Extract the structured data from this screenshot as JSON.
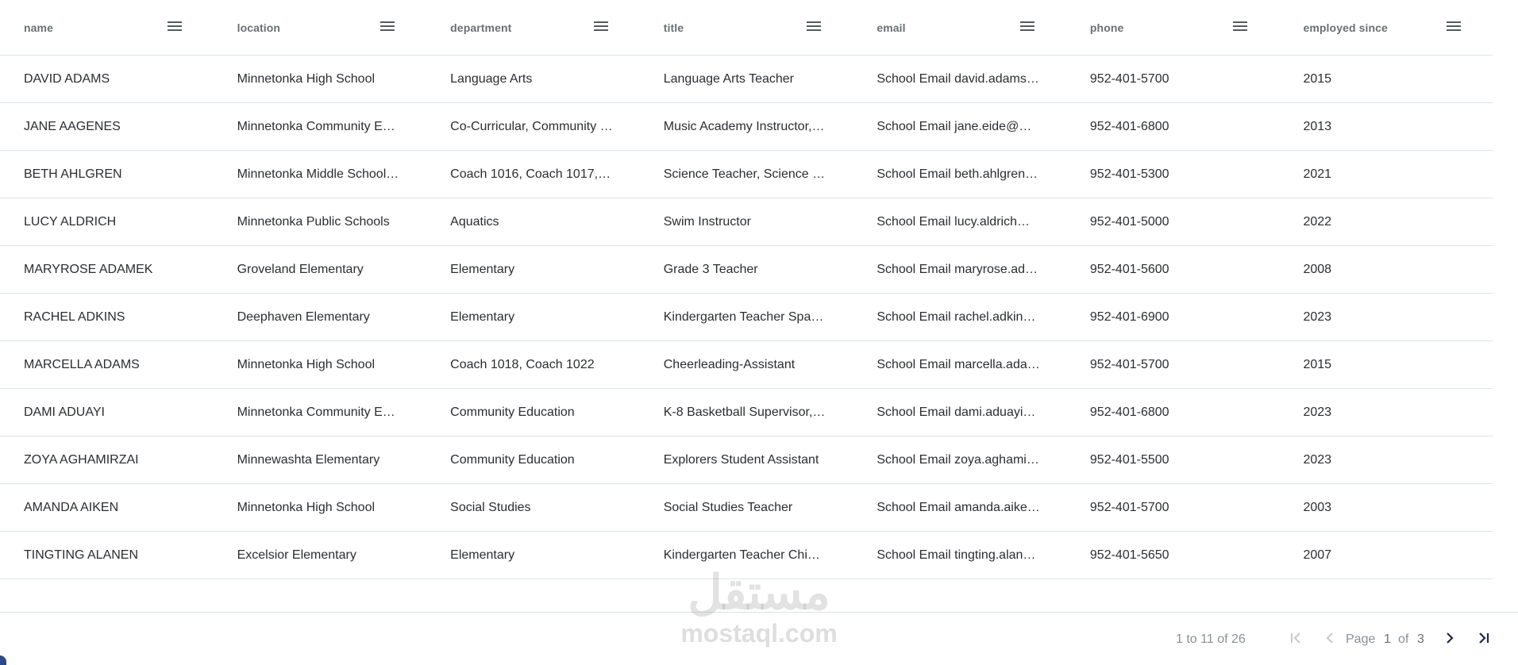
{
  "columns": [
    {
      "key": "name",
      "label": "name"
    },
    {
      "key": "location",
      "label": "location"
    },
    {
      "key": "department",
      "label": "department"
    },
    {
      "key": "title",
      "label": "title"
    },
    {
      "key": "email",
      "label": "email"
    },
    {
      "key": "phone",
      "label": "phone"
    },
    {
      "key": "employed_since",
      "label": "employed since"
    }
  ],
  "rows": [
    {
      "name": "DAVID ADAMS",
      "location": "Minnetonka High School",
      "department": "Language Arts",
      "title": "Language Arts Teacher",
      "email": "School Email david.adams…",
      "phone": "952-401-5700",
      "employed_since": "2015"
    },
    {
      "name": "JANE AAGENES",
      "location": "Minnetonka Community E…",
      "department": "Co-Curricular, Community …",
      "title": "Music Academy Instructor,…",
      "email": "School Email jane.eide@…",
      "phone": "952-401-6800",
      "employed_since": "2013"
    },
    {
      "name": "BETH AHLGREN",
      "location": "Minnetonka Middle School…",
      "department": "Coach 1016, Coach 1017,…",
      "title": "Science Teacher, Science …",
      "email": "School Email beth.ahlgren…",
      "phone": "952-401-5300",
      "employed_since": "2021"
    },
    {
      "name": "LUCY ALDRICH",
      "location": "Minnetonka Public Schools",
      "department": "Aquatics",
      "title": "Swim Instructor",
      "email": "School Email lucy.aldrich…",
      "phone": "952-401-5000",
      "employed_since": "2022"
    },
    {
      "name": "MARYROSE ADAMEK",
      "location": "Groveland Elementary",
      "department": "Elementary",
      "title": "Grade 3 Teacher",
      "email": "School Email maryrose.ad…",
      "phone": "952-401-5600",
      "employed_since": "2008"
    },
    {
      "name": "RACHEL ADKINS",
      "location": "Deephaven Elementary",
      "department": "Elementary",
      "title": "Kindergarten Teacher Spa…",
      "email": "School Email rachel.adkin…",
      "phone": "952-401-6900",
      "employed_since": "2023"
    },
    {
      "name": "MARCELLA ADAMS",
      "location": "Minnetonka High School",
      "department": "Coach 1018, Coach 1022",
      "title": "Cheerleading-Assistant",
      "email": "School Email marcella.ada…",
      "phone": "952-401-5700",
      "employed_since": "2015"
    },
    {
      "name": "DAMI ADUAYI",
      "location": "Minnetonka Community E…",
      "department": "Community Education",
      "title": "K-8 Basketball Supervisor,…",
      "email": "School Email dami.aduayi…",
      "phone": "952-401-6800",
      "employed_since": "2023"
    },
    {
      "name": "ZOYA AGHAMIRZAI",
      "location": "Minnewashta Elementary",
      "department": "Community Education",
      "title": "Explorers Student Assistant",
      "email": "School Email zoya.aghami…",
      "phone": "952-401-5500",
      "employed_since": "2023"
    },
    {
      "name": "AMANDA AIKEN",
      "location": "Minnetonka High School",
      "department": "Social Studies",
      "title": "Social Studies Teacher",
      "email": "School Email amanda.aike…",
      "phone": "952-401-5700",
      "employed_since": "2003"
    },
    {
      "name": "TINGTING ALANEN",
      "location": "Excelsior Elementary",
      "department": "Elementary",
      "title": "Kindergarten Teacher Chi…",
      "email": "School Email tingting.alan…",
      "phone": "952-401-5650",
      "employed_since": "2007"
    }
  ],
  "pagination": {
    "summary": "1 to 11 of 26",
    "page_label": "Page",
    "current_page": "1",
    "of_label": "of",
    "total_pages": "3"
  },
  "watermark": {
    "logo_text": "مستقل",
    "text": "mostaql.com"
  },
  "icons": {
    "column_menu": "menu-icon",
    "first_page": "first-page-icon",
    "prev_page": "chevron-left-icon",
    "next_page": "chevron-right-icon",
    "last_page": "last-page-icon"
  },
  "colors": {
    "header_text": "#6b6f75",
    "border": "#dde2eb",
    "disabled_icon": "#c5c9cf",
    "active_icon": "#1f2a44"
  }
}
